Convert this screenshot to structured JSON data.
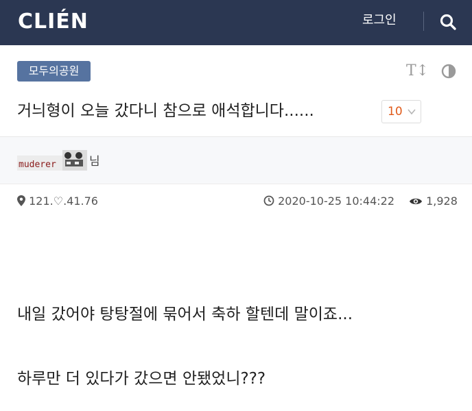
{
  "header": {
    "logo": "CLIÉN",
    "login_label": "로그인",
    "search_icon": "search-icon",
    "background_color": "#2b3752"
  },
  "post": {
    "board_tag": "모두의공원",
    "board_tag_color": "#5673a0",
    "font_size_icon": "text-size-icon",
    "font_size_label": "T↕",
    "contrast_icon": "contrast-icon",
    "title": "거늬형이 오늘 갔다니 참으로 애석합니다......",
    "comment_count": "10",
    "comment_count_color": "#e05b1b",
    "author_nick_image_text": "muderer",
    "author_suffix": "님",
    "ip": "121.♡.41.76",
    "timestamp": "2020-10-25 10:44:22",
    "views": "1,928",
    "body_lines": [
      "내일 갔어야 탕탕절에 묶어서 축하 할텐데 말이죠...",
      "하루만 더 있다가 갔으면 안됐었니???"
    ]
  }
}
